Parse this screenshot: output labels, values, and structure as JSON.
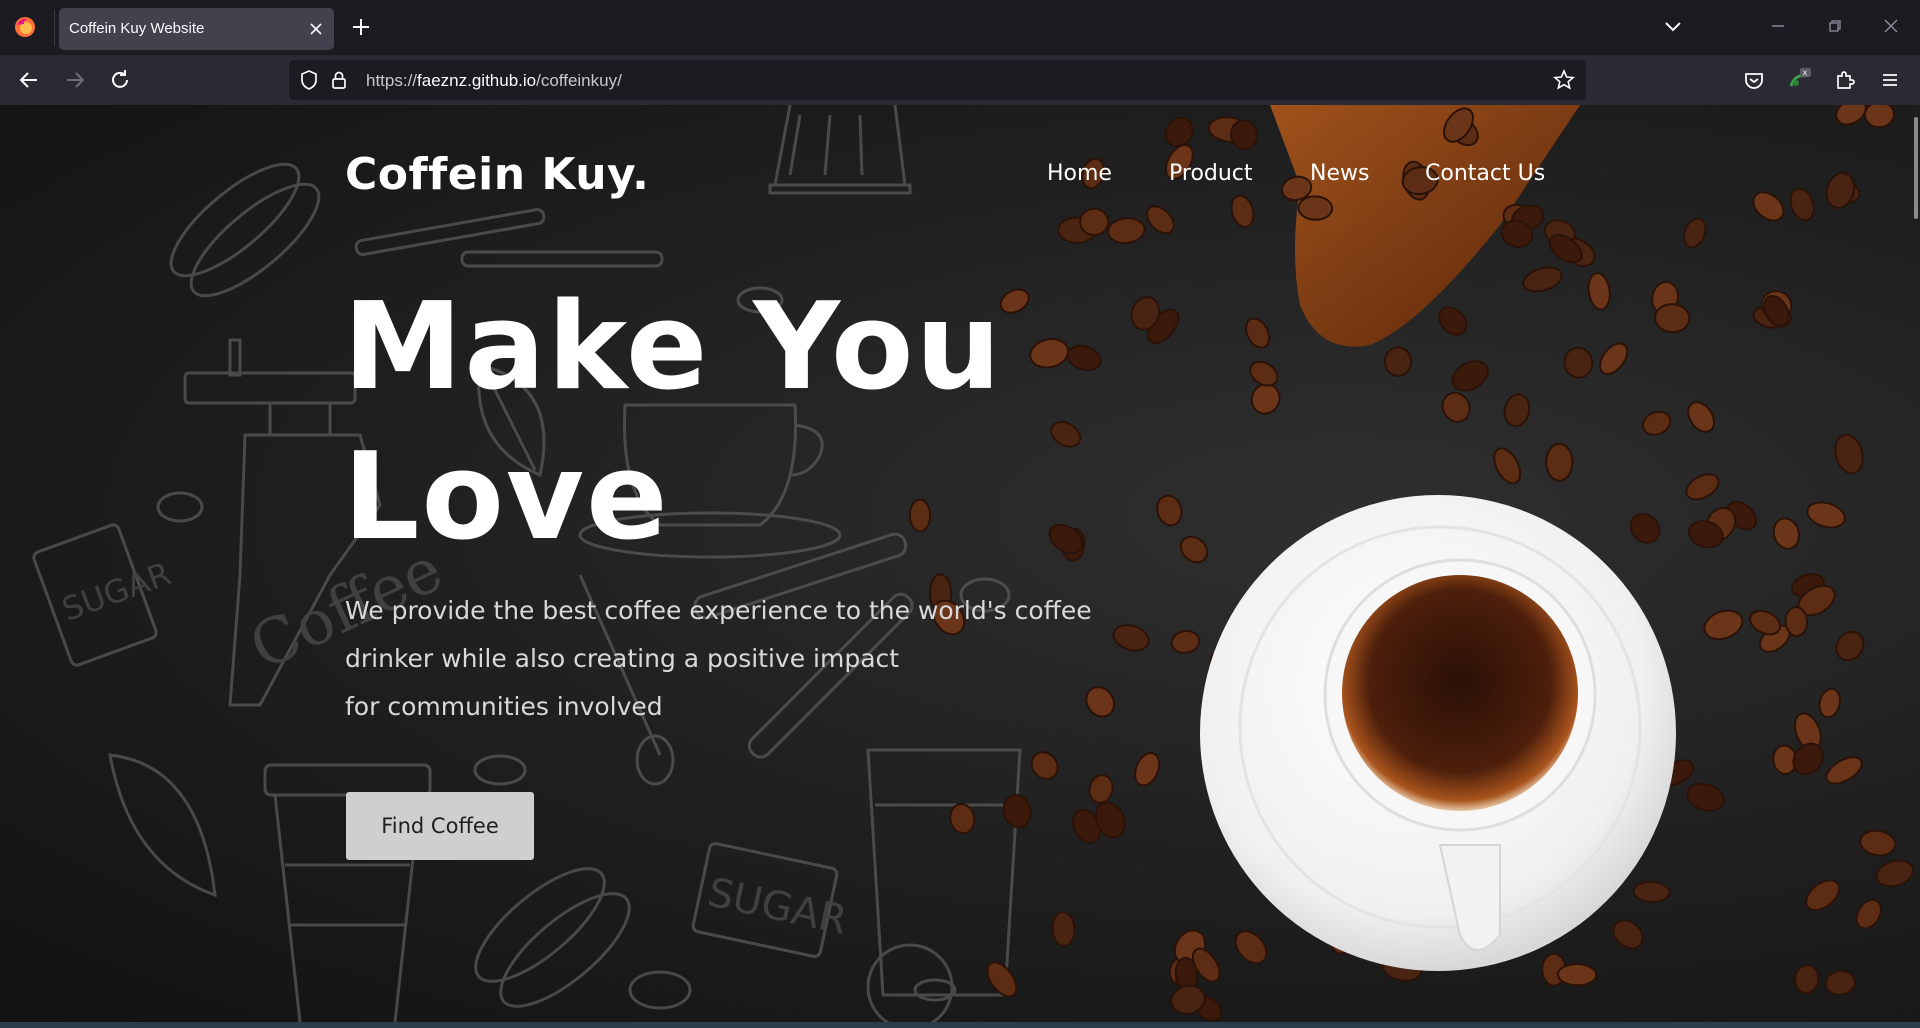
{
  "browser": {
    "tab": {
      "title": "Coffein Kuy Website"
    },
    "url": {
      "scheme": "https://",
      "host": "faeznz.github.io",
      "path": "/coffeinkuy/"
    },
    "icons": {
      "firefox": "firefox-logo-icon",
      "close_tab": "close-icon",
      "new_tab": "plus-icon",
      "list_tabs": "chevron-down-icon",
      "minimize": "minimize-icon",
      "restore": "restore-icon",
      "close_window": "close-icon",
      "back": "back-arrow-icon",
      "forward": "forward-arrow-icon",
      "reload": "reload-icon",
      "tracking": "shield-icon",
      "lock": "lock-icon",
      "bookmark": "star-icon",
      "pocket": "pocket-icon",
      "extension_badge": "extension-badge-icon",
      "extensions": "puzzle-icon",
      "menu": "hamburger-menu-icon"
    }
  },
  "site": {
    "logo": "Coffein Kuy.",
    "nav": [
      "Home",
      "Product",
      "News",
      "Contact Us"
    ],
    "hero": {
      "title_line1": "Make You",
      "title_line2": "Love",
      "desc_lines": [
        "We provide the best coffee experience to the world's coffee",
        "drinker while also creating a positive impact",
        "for communities involved"
      ],
      "button": "Find Coffee"
    }
  },
  "colors": {
    "chrome_bg": "#1c1b22",
    "toolbar_bg": "#2b2a33",
    "page_bg": "#1e1e1e",
    "button_bg": "#cfcfcf",
    "text_white": "#ffffff"
  }
}
